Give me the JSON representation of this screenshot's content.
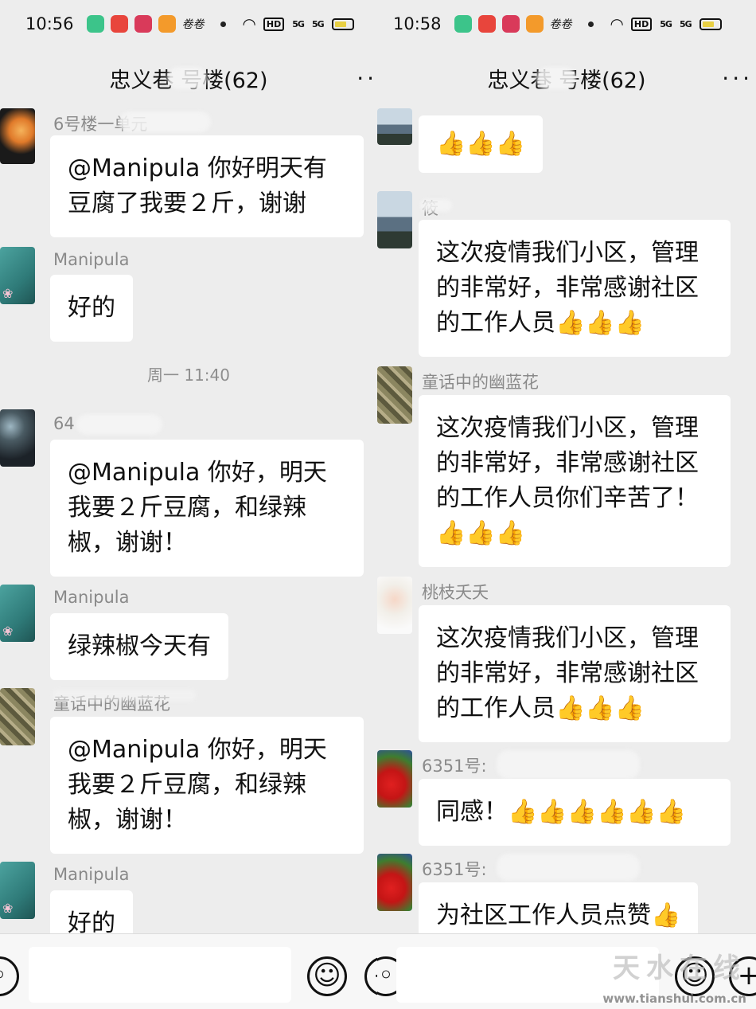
{
  "left": {
    "status": {
      "time": "10:56",
      "app_text": "卷卷",
      "hd": "HD",
      "sig1": "5G",
      "sig2": "5G"
    },
    "header": {
      "title": "忠义巷 号楼(62)",
      "menu": "··"
    },
    "messages": [
      {
        "name": "6号楼一单元",
        "text": "@Manipula 你好明天有豆腐了我要２斤，谢谢"
      },
      {
        "name": "Manipula",
        "text": "好的"
      },
      {
        "name": "64",
        "text": "@Manipula 你好，明天我要２斤豆腐，和绿辣椒，谢谢！"
      },
      {
        "name": "Manipula",
        "text": "绿辣椒今天有"
      },
      {
        "name": "童话中的幽蓝花",
        "text": "@Manipula 你好，明天我要２斤豆腐，和绿辣椒，谢谢！"
      },
      {
        "name": "Manipula",
        "text": "好的"
      }
    ],
    "timestamp": "周一 11:40"
  },
  "right": {
    "status": {
      "time": "10:58",
      "app_text": "卷卷",
      "hd": "HD",
      "sig1": "5G",
      "sig2": "5G"
    },
    "header": {
      "title": "忠义巷 号楼(62)",
      "menu": "···"
    },
    "messages": [
      {
        "name": "",
        "text": "",
        "thumbs": "👍👍👍"
      },
      {
        "name": "筱",
        "text": "这次疫情我们小区，管理的非常好，非常感谢社区的工作人员",
        "thumbs": "👍👍👍"
      },
      {
        "name": "童话中的幽蓝花",
        "text": "这次疫情我们小区，管理的非常好，非常感谢社区的工作人员你们辛苦了！",
        "thumbs": "👍👍👍"
      },
      {
        "name": "桃枝夭夭",
        "text": "这次疫情我们小区，管理的非常好，非常感谢社区的工作人员",
        "thumbs": "👍👍👍"
      },
      {
        "name": "6351号:",
        "text": "同感！",
        "thumbs": "👍👍👍👍👍👍"
      },
      {
        "name": "6351号:",
        "text": "为社区工作人员点赞",
        "thumbs": "👍"
      }
    ]
  },
  "icons": {
    "emoji": "smiley-face-icon",
    "plus": "plus-circle-icon",
    "wifi": "wifi-icon",
    "battery": "battery-icon"
  },
  "watermark": {
    "text": "天水在线",
    "url": "www.tianshui.com.cn"
  }
}
